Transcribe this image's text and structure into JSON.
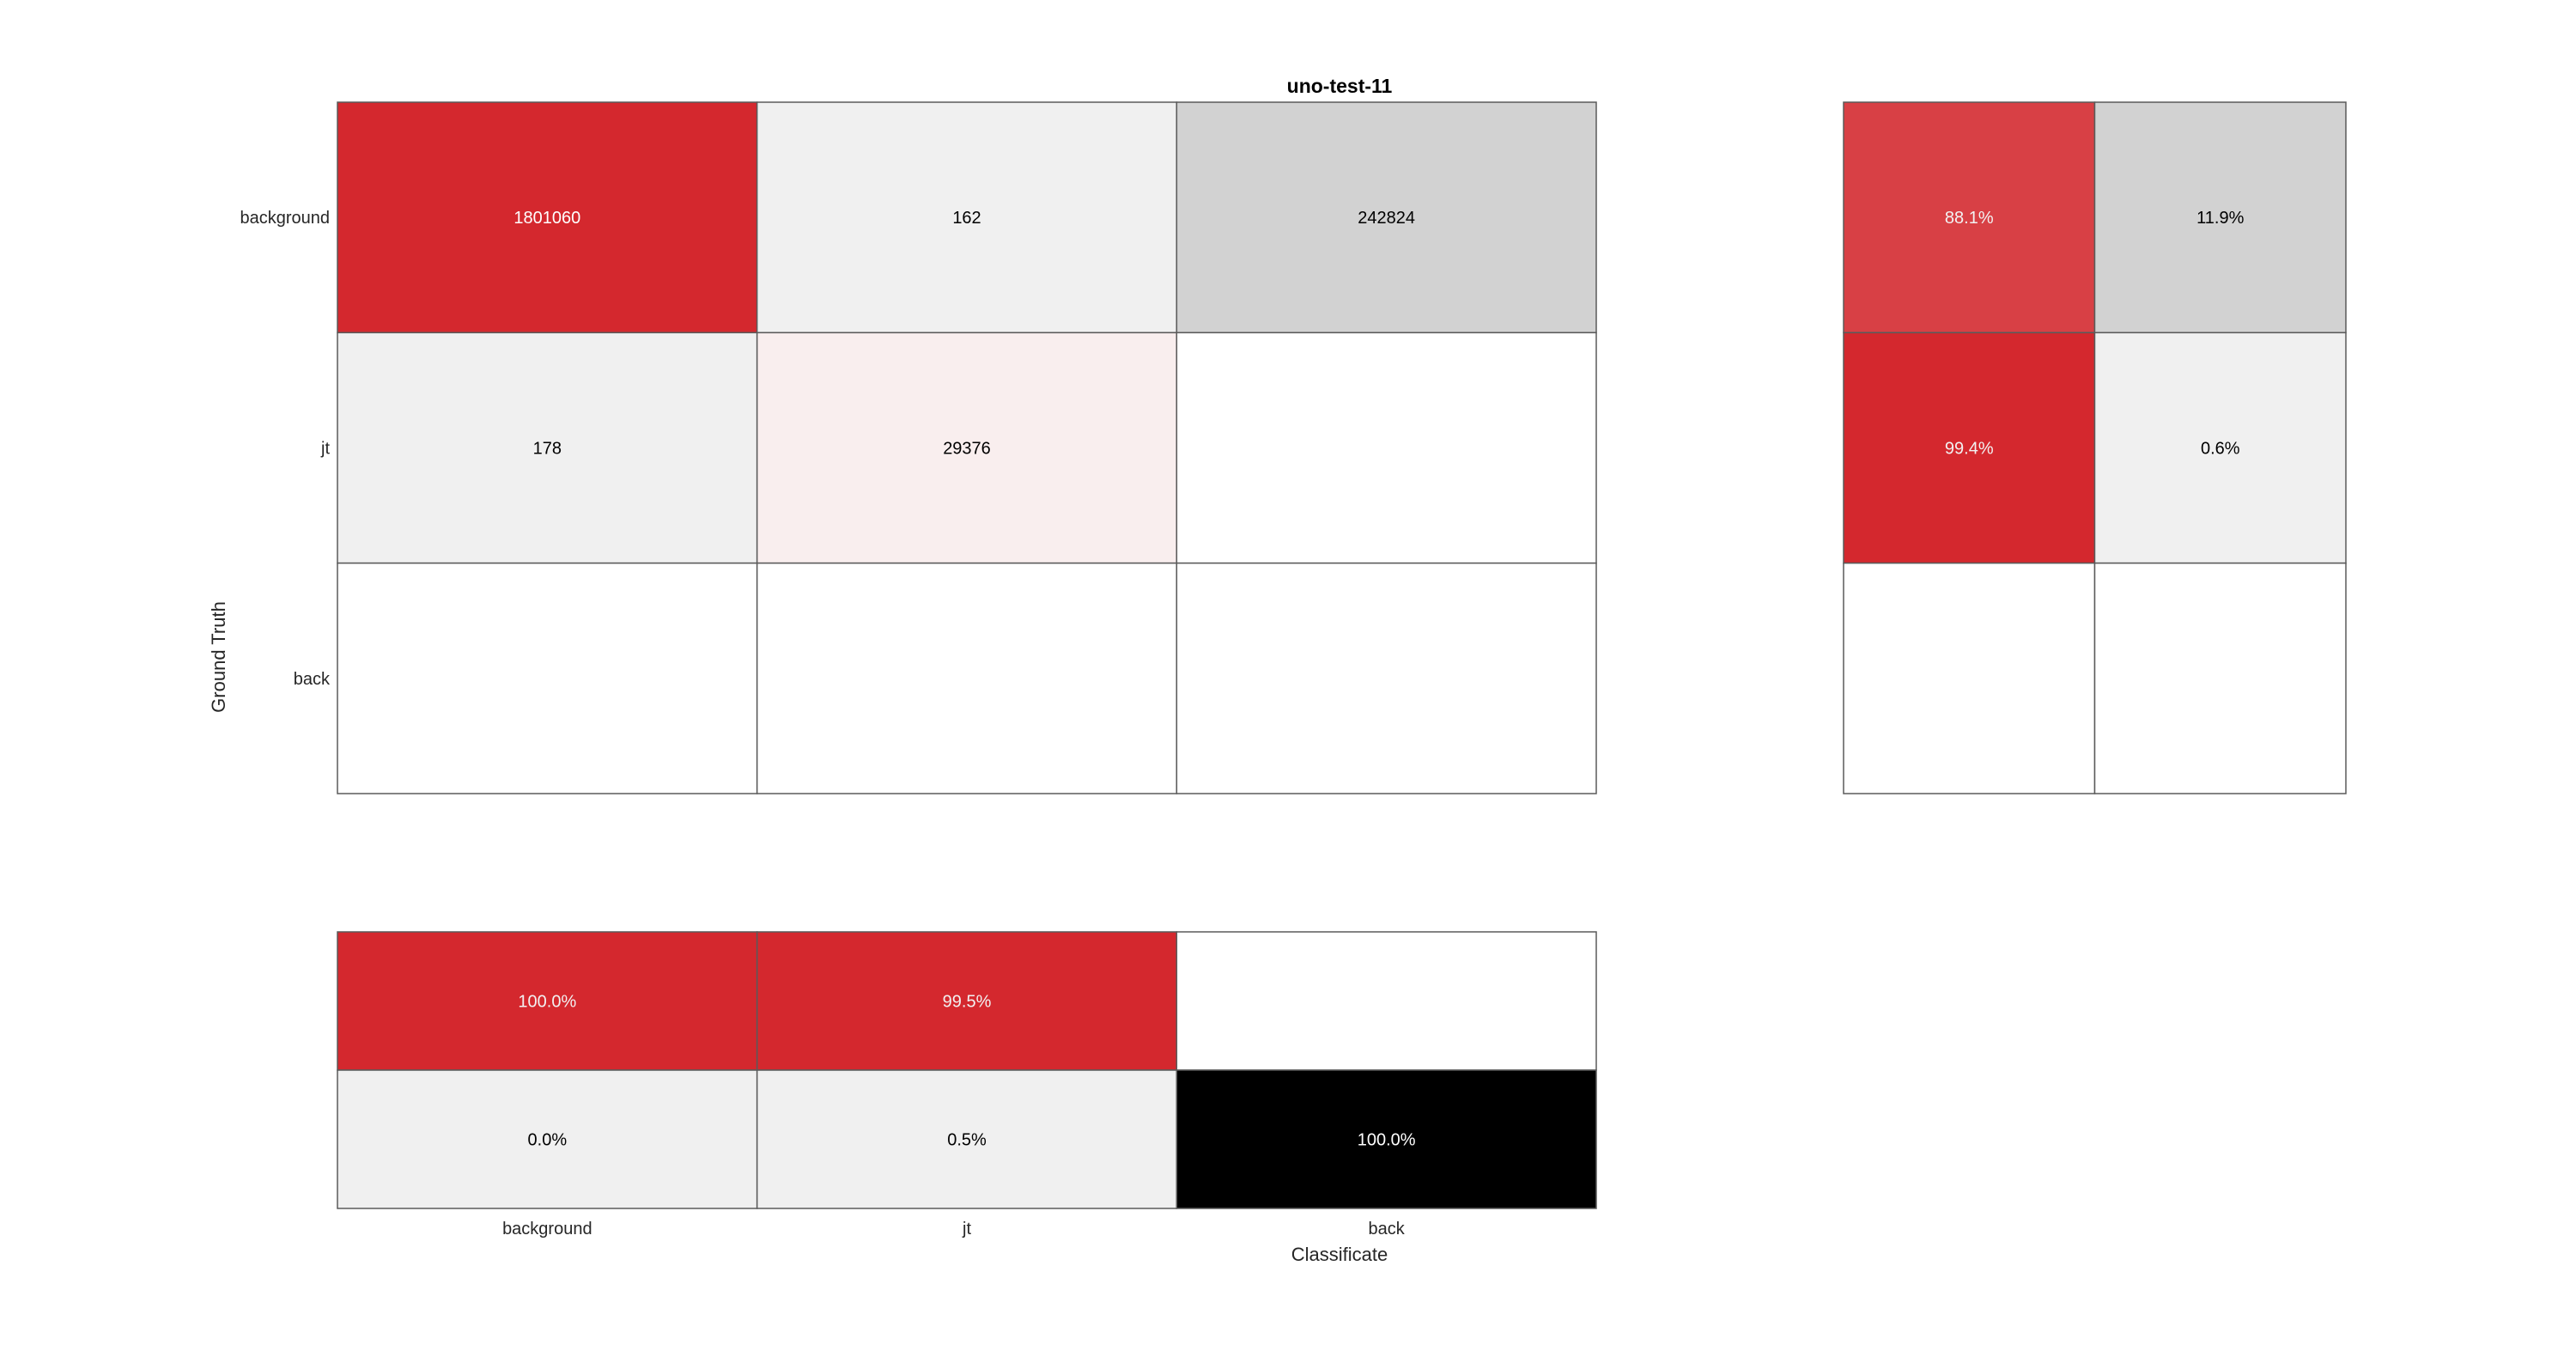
{
  "chart_data": {
    "type": "heatmap",
    "title": "uno-test-11",
    "xlabel": "Classificate",
    "ylabel": "Ground Truth",
    "row_labels": [
      "background",
      "jt",
      "back"
    ],
    "col_labels": [
      "background",
      "jt",
      "back"
    ],
    "main": {
      "cells": [
        [
          "1801060",
          "162",
          "242824"
        ],
        [
          "178",
          "29376",
          ""
        ],
        [
          "",
          "",
          ""
        ]
      ],
      "colors": [
        [
          "#d4282e",
          "#f0f0f0",
          "#d2d2d2"
        ],
        [
          "#f0f0f0",
          "#f9eeee",
          "#ffffff"
        ],
        [
          "#ffffff",
          "#ffffff",
          "#ffffff"
        ]
      ],
      "text_colors": [
        [
          "#ffffff",
          "#000000",
          "#000000"
        ],
        [
          "#000000",
          "#000000",
          "#000000"
        ],
        [
          "#000000",
          "#000000",
          "#000000"
        ]
      ]
    },
    "row_summary": {
      "cells": [
        [
          "88.1%",
          "11.9%"
        ],
        [
          "99.4%",
          "0.6%"
        ],
        [
          "",
          ""
        ]
      ],
      "colors": [
        [
          "#d84045",
          "#d2d2d2"
        ],
        [
          "#d4282e",
          "#f0f0f0"
        ],
        [
          "#ffffff",
          "#ffffff"
        ]
      ],
      "text_colors": [
        [
          "#f2f2f2",
          "#000000"
        ],
        [
          "#f2f2f2",
          "#000000"
        ],
        [
          "#000000",
          "#000000"
        ]
      ]
    },
    "column_summary": {
      "cells": [
        [
          "100.0%",
          "99.5%",
          ""
        ],
        [
          "0.0%",
          "0.5%",
          "100.0%"
        ]
      ],
      "colors": [
        [
          "#d4282e",
          "#d4282e",
          "#ffffff"
        ],
        [
          "#f0f0f0",
          "#f0f0f0",
          "#000000"
        ]
      ],
      "text_colors": [
        [
          "#f2f2f2",
          "#f2f2f2",
          "#000000"
        ],
        [
          "#000000",
          "#000000",
          "#ffffff"
        ]
      ]
    }
  }
}
